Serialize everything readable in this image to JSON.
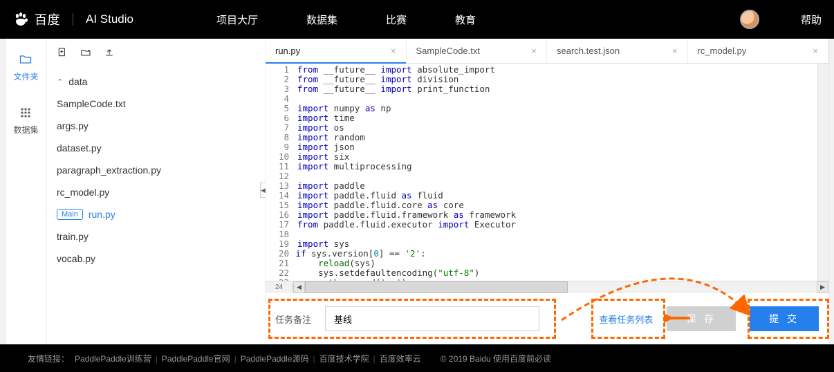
{
  "header": {
    "brand": "百度",
    "studio": "AI Studio",
    "nav": [
      "项目大厅",
      "数据集",
      "比赛",
      "教育"
    ],
    "help": "帮助"
  },
  "sidebar": {
    "files": "文件夹",
    "datasets": "数据集"
  },
  "tree": {
    "folder": "data",
    "files": [
      "SampleCode.txt",
      "args.py",
      "dataset.py",
      "paragraph_extraction.py",
      "rc_model.py",
      "run.py",
      "train.py",
      "vocab.py"
    ],
    "main_badge": "Main"
  },
  "tabs": [
    {
      "label": "run.py",
      "active": true
    },
    {
      "label": "SampleCode.txt",
      "active": false
    },
    {
      "label": "search.test.json",
      "active": false
    },
    {
      "label": "rc_model.py",
      "active": false
    }
  ],
  "code_lines": [
    [
      [
        "k",
        "from"
      ],
      [
        "p",
        " __future__ "
      ],
      [
        "k",
        "import"
      ],
      [
        "p",
        " absolute_import"
      ]
    ],
    [
      [
        "k",
        "from"
      ],
      [
        "p",
        " __future__ "
      ],
      [
        "k",
        "import"
      ],
      [
        "p",
        " division"
      ]
    ],
    [
      [
        "k",
        "from"
      ],
      [
        "p",
        " __future__ "
      ],
      [
        "k",
        "import"
      ],
      [
        "p",
        " print_function"
      ]
    ],
    [
      [
        "p",
        ""
      ]
    ],
    [
      [
        "k",
        "import"
      ],
      [
        "p",
        " numpy "
      ],
      [
        "k",
        "as"
      ],
      [
        "p",
        " np"
      ]
    ],
    [
      [
        "k",
        "import"
      ],
      [
        "p",
        " time"
      ]
    ],
    [
      [
        "k",
        "import"
      ],
      [
        "p",
        " os"
      ]
    ],
    [
      [
        "k",
        "import"
      ],
      [
        "p",
        " random"
      ]
    ],
    [
      [
        "k",
        "import"
      ],
      [
        "p",
        " json"
      ]
    ],
    [
      [
        "k",
        "import"
      ],
      [
        "p",
        " six"
      ]
    ],
    [
      [
        "k",
        "import"
      ],
      [
        "p",
        " multiprocessing"
      ]
    ],
    [
      [
        "p",
        ""
      ]
    ],
    [
      [
        "k",
        "import"
      ],
      [
        "p",
        " paddle"
      ]
    ],
    [
      [
        "k",
        "import"
      ],
      [
        "p",
        " paddle.fluid "
      ],
      [
        "k",
        "as"
      ],
      [
        "p",
        " fluid"
      ]
    ],
    [
      [
        "k",
        "import"
      ],
      [
        "p",
        " paddle.fluid.core "
      ],
      [
        "k",
        "as"
      ],
      [
        "p",
        " core"
      ]
    ],
    [
      [
        "k",
        "import"
      ],
      [
        "p",
        " paddle.fluid.framework "
      ],
      [
        "k",
        "as"
      ],
      [
        "p",
        " framework"
      ]
    ],
    [
      [
        "k",
        "from"
      ],
      [
        "p",
        " paddle.fluid.executor "
      ],
      [
        "k",
        "import"
      ],
      [
        "p",
        " Executor"
      ]
    ],
    [
      [
        "p",
        ""
      ]
    ],
    [
      [
        "k",
        "import"
      ],
      [
        "p",
        " sys"
      ]
    ],
    [
      [
        "k",
        "if"
      ],
      [
        "p",
        " sys.version["
      ],
      [
        "b",
        "0"
      ],
      [
        "p",
        "] == "
      ],
      [
        "s",
        "'2'"
      ],
      [
        "p",
        ":"
      ]
    ],
    [
      [
        "p",
        "    "
      ],
      [
        "n",
        "reload"
      ],
      [
        "p",
        "(sys)"
      ]
    ],
    [
      [
        "p",
        "    sys.setdefaultencoding("
      ],
      [
        "s",
        "\"utf-8\""
      ],
      [
        "p",
        ")"
      ]
    ],
    [
      [
        "p",
        "sys.path.append("
      ],
      [
        "s",
        "'..'"
      ],
      [
        "p",
        ")"
      ]
    ],
    [
      [
        "p",
        ""
      ]
    ]
  ],
  "bottom": {
    "label": "任务备注",
    "value": "基线",
    "view_link": "查看任务列表",
    "save": "保 存",
    "submit": "提 交"
  },
  "footer": {
    "prefix": "友情链接：",
    "links": [
      "PaddlePaddle训练营",
      "PaddlePaddle官网",
      "PaddlePaddle源码",
      "百度技术学院",
      "百度效率云"
    ],
    "copyright": "© 2019 Baidu 使用百度前必读"
  }
}
